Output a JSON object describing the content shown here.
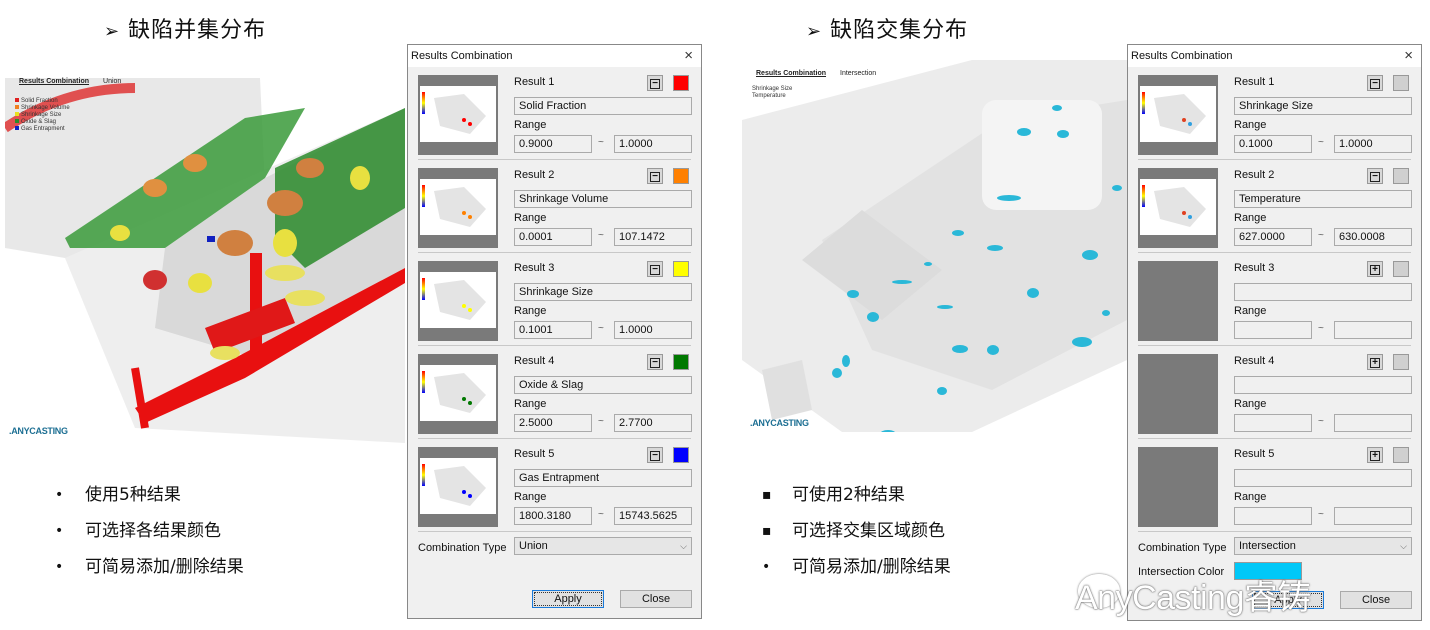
{
  "left": {
    "title_arrow": "➢",
    "title": "缺陷并集分布",
    "viewport": {
      "header_label": "Results Combination",
      "header_mode": "Union",
      "legend": [
        {
          "name": "Solid Fraction",
          "color": "#e02020"
        },
        {
          "name": "Shrinkage Volume",
          "color": "#f08020"
        },
        {
          "name": "Shrinkage Size",
          "color": "#e8e020"
        },
        {
          "name": "Oxide & Slag",
          "color": "#2a8a2a"
        },
        {
          "name": "Gas Entrapment",
          "color": "#1020c0"
        }
      ],
      "logo": ".ANYCASTING"
    },
    "bullets": [
      {
        "mark": "•",
        "text": "使用5种结果"
      },
      {
        "mark": "•",
        "text": "可选择各结果颜色"
      },
      {
        "mark": "•",
        "text": "可简易添加/删除结果"
      }
    ],
    "dialog": {
      "title": "Results Combination",
      "close_icon": "×",
      "range_label": "Range",
      "tilde": "~",
      "results": [
        {
          "label": "Result 1",
          "name": "Solid Fraction",
          "min": "0.9000",
          "max": "1.0000",
          "color": "#ff0000",
          "button": "−",
          "thumb": true
        },
        {
          "label": "Result 2",
          "name": "Shrinkage Volume",
          "min": "0.0001",
          "max": "107.1472",
          "color": "#ff8000",
          "button": "−",
          "thumb": true
        },
        {
          "label": "Result 3",
          "name": "Shrinkage Size",
          "min": "0.1001",
          "max": "1.0000",
          "color": "#ffff00",
          "button": "−",
          "thumb": true
        },
        {
          "label": "Result 4",
          "name": "Oxide & Slag",
          "min": "2.5000",
          "max": "2.7700",
          "color": "#007800",
          "button": "−",
          "thumb": true
        },
        {
          "label": "Result 5",
          "name": "Gas Entrapment",
          "min": "1800.3180",
          "max": "15743.5625",
          "color": "#0000ff",
          "button": "−",
          "thumb": true
        }
      ],
      "combination_type_label": "Combination Type",
      "combination_type_value": "Union",
      "apply_label": "Apply",
      "close_label": "Close"
    }
  },
  "right": {
    "title_arrow": "➢",
    "title": "缺陷交集分布",
    "viewport": {
      "header_label": "Results Combination",
      "header_mode": "Intersection",
      "legend": [
        {
          "name": "Shrinkage Size"
        },
        {
          "name": "Temperature"
        }
      ],
      "logo": ".ANYCASTING",
      "defect_color": "#2ab8d8"
    },
    "bullets": [
      {
        "mark": "▪",
        "text": "可使用2种结果"
      },
      {
        "mark": "▪",
        "text": "可选择交集区域颜色"
      },
      {
        "mark": "•",
        "text": "可简易添加/删除结果"
      }
    ],
    "dialog": {
      "title": "Results Combination",
      "close_icon": "×",
      "range_label": "Range",
      "tilde": "~",
      "results": [
        {
          "label": "Result 1",
          "name": "Shrinkage Size",
          "min": "0.1000",
          "max": "1.0000",
          "color": "#d0d0d0",
          "button": "−",
          "thumb": true
        },
        {
          "label": "Result 2",
          "name": "Temperature",
          "min": "627.0000",
          "max": "630.0008",
          "color": "#d0d0d0",
          "button": "−",
          "thumb": true
        },
        {
          "label": "Result 3",
          "name": "",
          "min": "",
          "max": "",
          "color": "#d0d0d0",
          "button": "+",
          "thumb": false
        },
        {
          "label": "Result 4",
          "name": "",
          "min": "",
          "max": "",
          "color": "#d0d0d0",
          "button": "+",
          "thumb": false
        },
        {
          "label": "Result 5",
          "name": "",
          "min": "",
          "max": "",
          "color": "#d0d0d0",
          "button": "+",
          "thumb": false
        }
      ],
      "combination_type_label": "Combination Type",
      "combination_type_value": "Intersection",
      "intersection_color_label": "Intersection Color",
      "intersection_color": "#00c8f8",
      "apply_label": "Apply",
      "close_label": "Close"
    }
  },
  "watermark": "AnyCasting睿铸"
}
